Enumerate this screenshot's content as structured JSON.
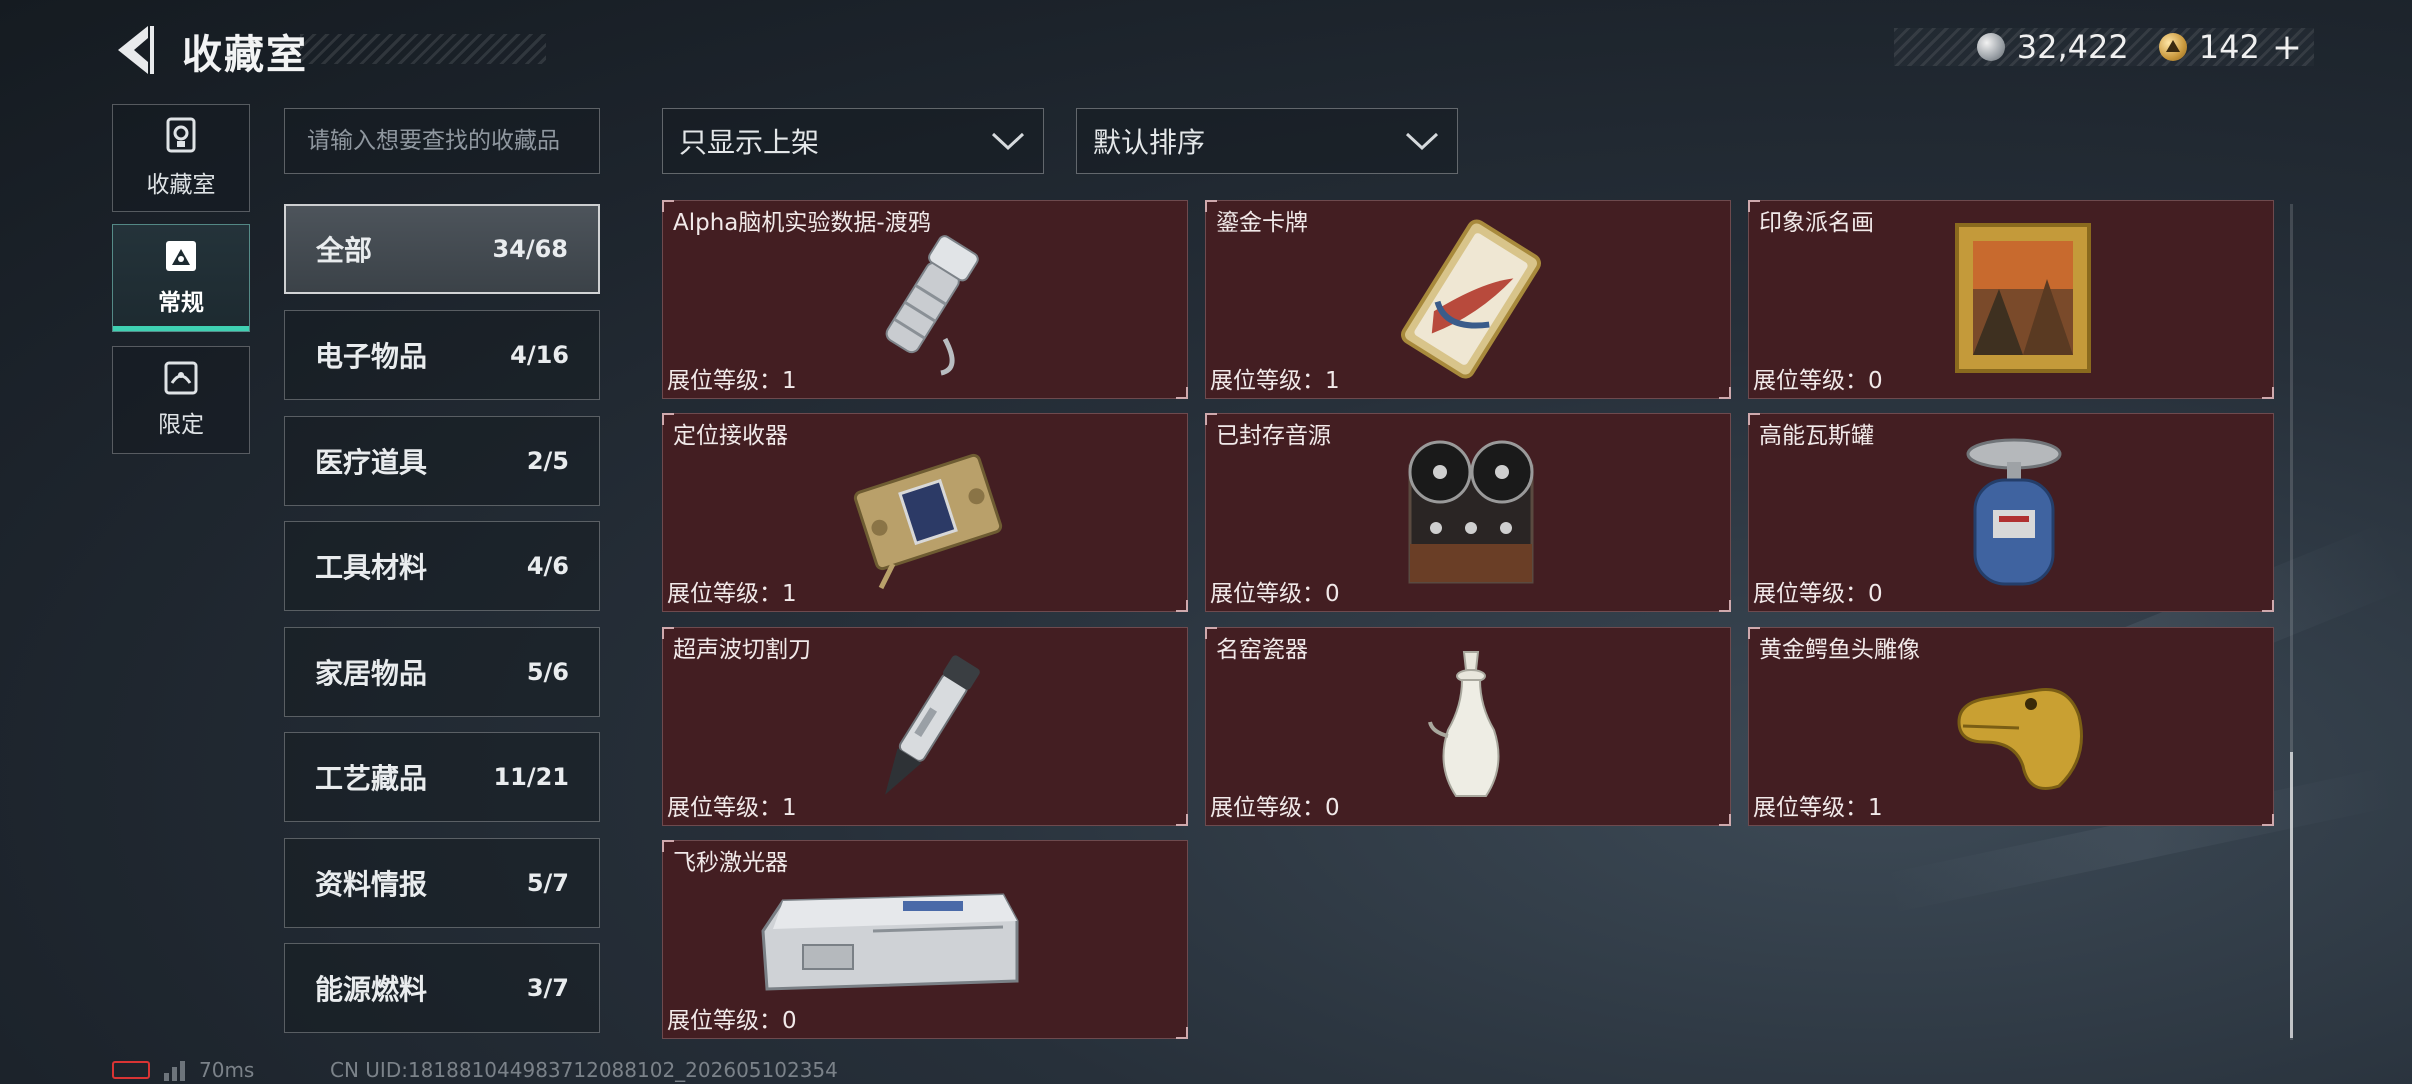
{
  "header": {
    "back_icon": "back-arrow-icon",
    "title": "收藏室",
    "currency_silver": "32,422",
    "currency_gold": "142",
    "plus": "+"
  },
  "mode_tabs": [
    {
      "label": "收藏室",
      "icon": "trophy-icon",
      "active": false
    },
    {
      "label": "常规",
      "icon": "image-icon",
      "active": true
    },
    {
      "label": "限定",
      "icon": "limited-icon",
      "active": false
    }
  ],
  "search": {
    "placeholder": "请输入想要查找的收藏品"
  },
  "categories": [
    {
      "name": "全部",
      "count": "34/68",
      "active": true
    },
    {
      "name": "电子物品",
      "count": "4/16"
    },
    {
      "name": "医疗道具",
      "count": "2/5"
    },
    {
      "name": "工具材料",
      "count": "4/6"
    },
    {
      "name": "家居物品",
      "count": "5/6"
    },
    {
      "name": "工艺藏品",
      "count": "11/21"
    },
    {
      "name": "资料情报",
      "count": "5/7"
    },
    {
      "name": "能源燃料",
      "count": "3/7"
    }
  ],
  "filters": {
    "display_filter": "只显示上架",
    "sort_order": "默认排序"
  },
  "items": [
    {
      "name": "Alpha脑机实验数据-渡鸦",
      "level_label": "展位等级：",
      "level": "1",
      "icon": "flashlight-icon"
    },
    {
      "name": "鎏金卡牌",
      "level_label": "展位等级：",
      "level": "1",
      "icon": "gilded-card-icon"
    },
    {
      "name": "印象派名画",
      "level_label": "展位等级：",
      "level": "0",
      "icon": "painting-icon"
    },
    {
      "name": "定位接收器",
      "level_label": "展位等级：",
      "level": "1",
      "icon": "receiver-icon"
    },
    {
      "name": "已封存音源",
      "level_label": "展位等级：",
      "level": "0",
      "icon": "reel-recorder-icon"
    },
    {
      "name": "高能瓦斯罐",
      "level_label": "展位等级：",
      "level": "0",
      "icon": "gas-tank-icon"
    },
    {
      "name": "超声波切割刀",
      "level_label": "展位等级：",
      "level": "1",
      "icon": "ultrasonic-knife-icon"
    },
    {
      "name": "名窑瓷器",
      "level_label": "展位等级：",
      "level": "0",
      "icon": "porcelain-vase-icon"
    },
    {
      "name": "黄金鳄鱼头雕像",
      "level_label": "展位等级：",
      "level": "1",
      "icon": "gold-crocodile-icon"
    },
    {
      "name": "飞秒激光器",
      "level_label": "展位等级：",
      "level": "0",
      "icon": "laser-device-icon"
    }
  ],
  "footer": {
    "ping": "70ms",
    "uid": "CN UID:181881044983712088102_202605102354"
  }
}
